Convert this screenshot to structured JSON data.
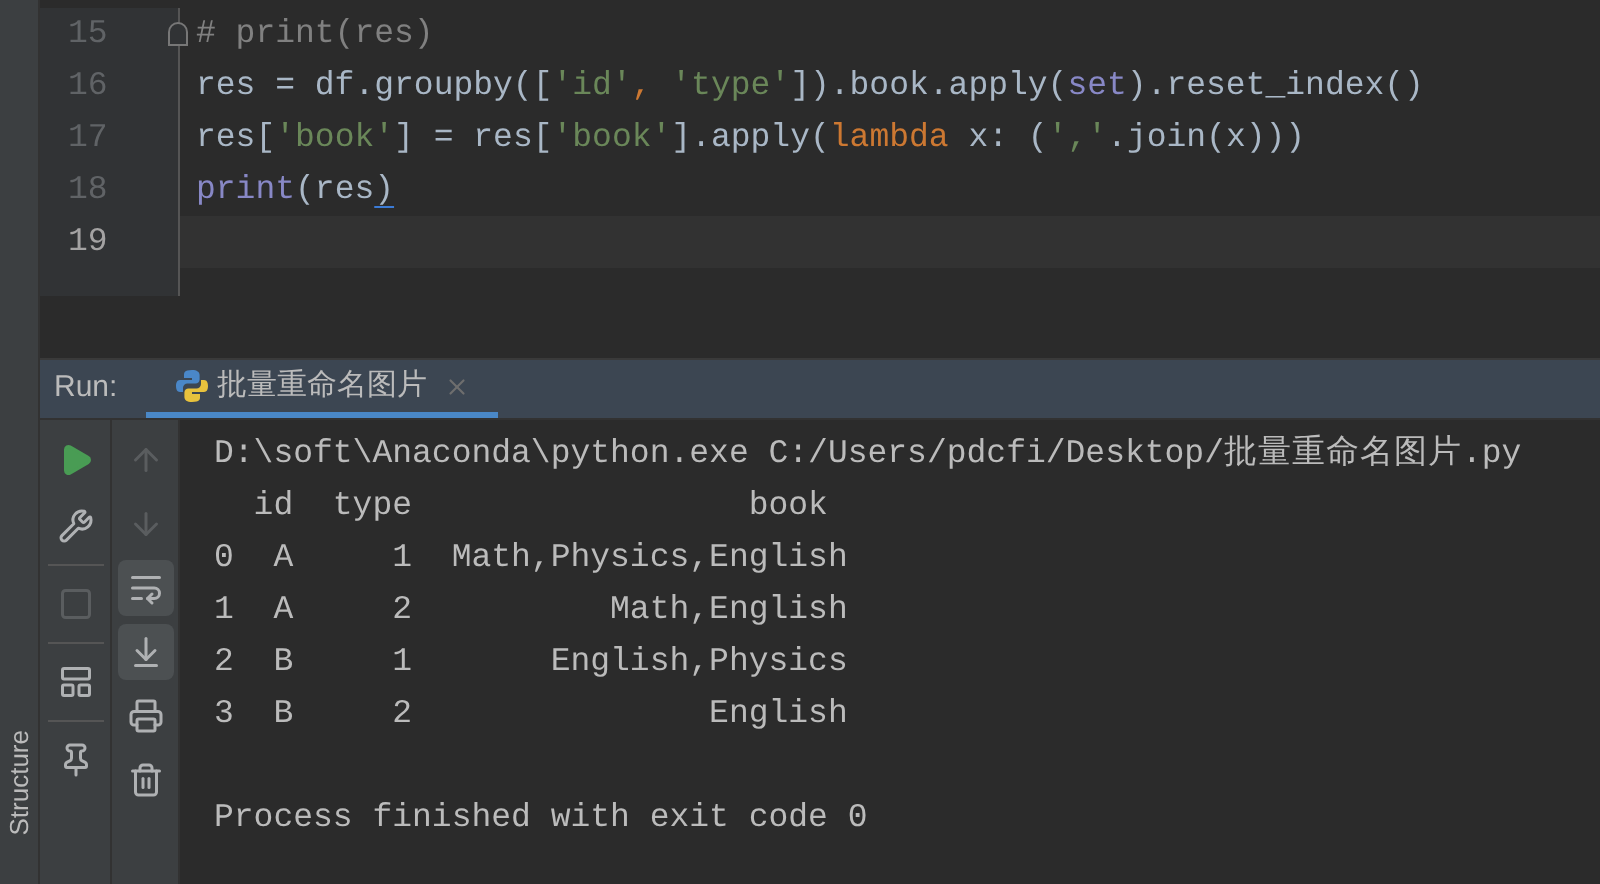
{
  "editor": {
    "lines": [
      {
        "number": "15",
        "current": false,
        "folded_marker": true,
        "tokens": [
          {
            "kind": "comment",
            "text": "# print(res)"
          }
        ]
      },
      {
        "number": "16",
        "current": false,
        "tokens": [
          {
            "kind": "plain",
            "text": "res = df.groupby(["
          },
          {
            "kind": "string",
            "text": "'id'"
          },
          {
            "kind": "keyword",
            "text": ", "
          },
          {
            "kind": "string",
            "text": "'type'"
          },
          {
            "kind": "plain",
            "text": "]).book.apply("
          },
          {
            "kind": "builtin",
            "text": "set"
          },
          {
            "kind": "plain",
            "text": ").reset_index()"
          }
        ]
      },
      {
        "number": "17",
        "current": false,
        "tokens": [
          {
            "kind": "plain",
            "text": "res["
          },
          {
            "kind": "string",
            "text": "'book'"
          },
          {
            "kind": "plain",
            "text": "] = res["
          },
          {
            "kind": "string",
            "text": "'book'"
          },
          {
            "kind": "plain",
            "text": "].apply("
          },
          {
            "kind": "keyword",
            "text": "lambda"
          },
          {
            "kind": "plain",
            "text": " x: ("
          },
          {
            "kind": "string",
            "text": "','"
          },
          {
            "kind": "plain",
            "text": ".join(x)))"
          }
        ]
      },
      {
        "number": "18",
        "current": false,
        "tokens": [
          {
            "kind": "builtin",
            "text": "print"
          },
          {
            "kind": "plain",
            "text": "(res"
          },
          {
            "kind": "matched",
            "text": ")"
          }
        ]
      },
      {
        "number": "19",
        "current": true
      }
    ]
  },
  "run_panel": {
    "label": "Run:",
    "tabs": [
      {
        "label": "批量重命名图片",
        "selected": true
      }
    ],
    "toolbar": {
      "rerun": {
        "disabled": false
      },
      "settings": {
        "disabled": false
      },
      "stop": {
        "disabled": true
      },
      "layout": {
        "disabled": false
      },
      "pin": {
        "disabled": false
      },
      "up": {
        "disabled": true
      },
      "down": {
        "disabled": true
      },
      "soft_wrap": {
        "on": true
      },
      "scroll_to_end": {
        "on": true
      },
      "print": {
        "disabled": false
      },
      "clear": {
        "disabled": false
      }
    },
    "console": [
      {
        "text": "D:\\soft\\Anaconda\\python.exe C:/Users/pdcfi/Desktop/批量重命名图片.py",
        "blank_line_before": false
      },
      {
        "text": "  id  type                 book",
        "blank_line_before": false
      },
      {
        "text": "0  A     1  Math,Physics,English",
        "blank_line_before": false
      },
      {
        "text": "1  A     2          Math,English",
        "blank_line_before": false
      },
      {
        "text": "2  B     1       English,Physics",
        "blank_line_before": false
      },
      {
        "text": "3  B     2               English",
        "blank_line_before": false
      },
      {
        "text": "Process finished with exit code 0",
        "blank_line_before": true
      }
    ]
  },
  "side_bar": {
    "label": "Structure"
  }
}
